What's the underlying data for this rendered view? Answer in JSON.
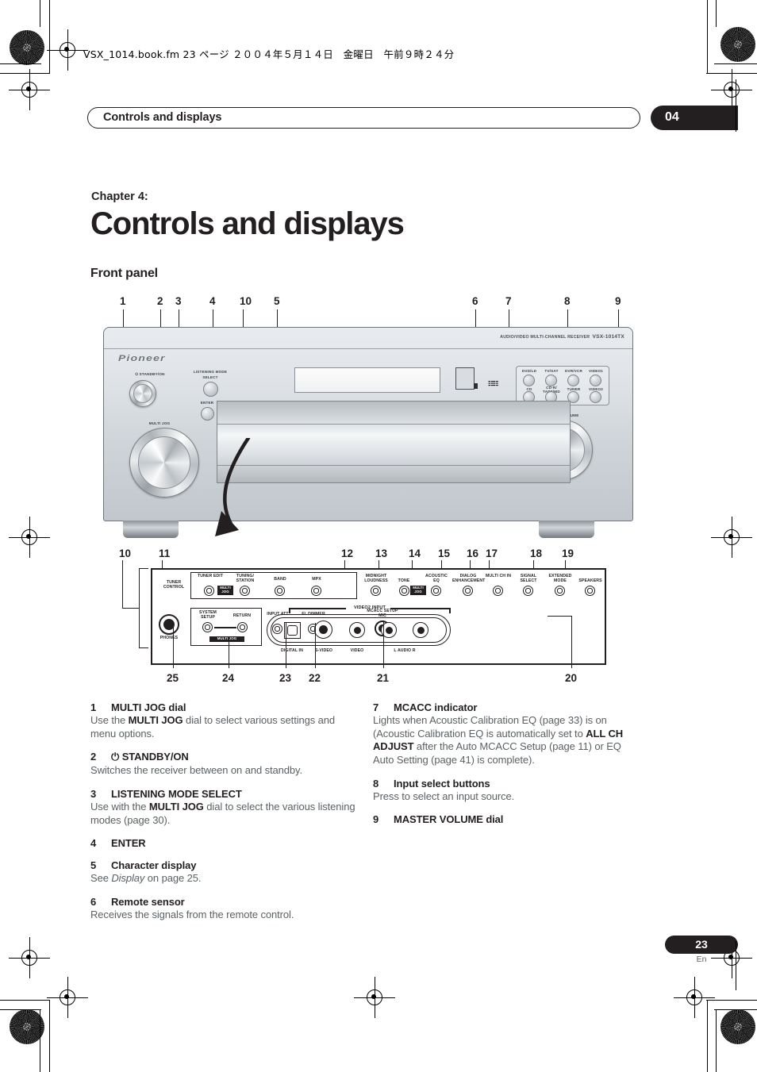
{
  "header": {
    "fm_line": "VSX_1014.book.fm 23 ページ ２００４年５月１４日　金曜日　午前９時２４分",
    "running_head": "Controls and displays",
    "chapter_number": "04"
  },
  "title": {
    "chapter_label": "Chapter 4:",
    "chapter_title": "Controls and displays",
    "section": "Front panel"
  },
  "figure_front": {
    "callouts_top": [
      "1",
      "2",
      "3",
      "4",
      "10",
      "5",
      "6",
      "7",
      "8",
      "9"
    ],
    "brand": "Pioneer",
    "model_prefix": "AUDIO/VIDEO MULTI-CHANNEL RECEIVER",
    "model": "VSX-1014TX",
    "labels": {
      "standby": "STANDBY/ON",
      "listening_mode": "LISTENING MODE",
      "select": "SELECT",
      "enter": "ENTER",
      "multi_jog": "MULTI JOG",
      "master_volume": "MASTER VOLUME"
    },
    "input_buttons": [
      "DVD/LD",
      "TV/SAT",
      "DVR/VCR",
      "VIDEO1",
      "CD",
      "CD-R/ TAPE/MD",
      "TUNER",
      "VIDEO2"
    ]
  },
  "figure_lower": {
    "callouts_top": [
      "10",
      "11",
      "12",
      "13",
      "14",
      "15",
      "16",
      "17",
      "18",
      "19"
    ],
    "callouts_bottom": [
      "25",
      "24",
      "23",
      "22",
      "21",
      "20"
    ],
    "tuner_control": "TUNER CONTROL",
    "tuner_row": [
      "TUNER EDIT",
      "TUNING/ STATION",
      "BAND",
      "MPX"
    ],
    "multi_jog_tag": "MULTI JOG",
    "multi_jog_tag2": "MULTI JOG",
    "multi_jog_tag3": "MULTI JOG",
    "right_row": [
      "MIDNIGHT LOUDNESS",
      "TONE",
      "ACOUSTIC EQ",
      "DIALOG ENHANCEMENT",
      "MULTI CH IN",
      "SIGNAL SELECT",
      "EXTENDED MODE",
      "SPEAKERS"
    ],
    "setup_row": [
      "SYSTEM SETUP",
      "RETURN"
    ],
    "att": "INPUT ATT",
    "dimmer": "FL DIMMER",
    "phones": "PHONES",
    "mcacc_mic": "MCACC SETUP MIC",
    "video2_title": "VIDEO2  INPUT",
    "video2_jacks": [
      "DIGITAL IN",
      "S-VIDEO",
      "VIDEO",
      "L   AUDIO   R"
    ]
  },
  "left_column": [
    {
      "num": "1",
      "head": "MULTI JOG dial",
      "body_html": "Use the <b>MULTI JOG</b> dial to select various settings and menu options."
    },
    {
      "num": "2",
      "head": "⏻ STANDBY/ON",
      "body_html": "Switches the receiver between on and standby."
    },
    {
      "num": "3",
      "head": "LISTENING MODE SELECT",
      "body_html": "Use with the <b>MULTI JOG</b> dial to select the various listening modes (page 30)."
    },
    {
      "num": "4",
      "head": "ENTER",
      "body_html": ""
    },
    {
      "num": "5",
      "head": "Character display",
      "body_html": "See <i>Display</i> on page 25."
    },
    {
      "num": "6",
      "head": "Remote sensor",
      "body_html": "Receives the signals from the remote control."
    }
  ],
  "right_column": [
    {
      "num": "7",
      "head": "MCACC indicator",
      "body_html": "Lights when Acoustic Calibration EQ (page 33) is on (Acoustic Calibration EQ is automatically set to <b>ALL CH ADJUST</b> after the Auto MCACC Setup (page 11) or EQ Auto Setting (page 41) is complete)."
    },
    {
      "num": "8",
      "head": "Input select buttons",
      "body_html": "Press to select an input source."
    },
    {
      "num": "9",
      "head": "MASTER VOLUME dial",
      "body_html": ""
    }
  ],
  "footer": {
    "page_number": "23",
    "language": "En"
  }
}
